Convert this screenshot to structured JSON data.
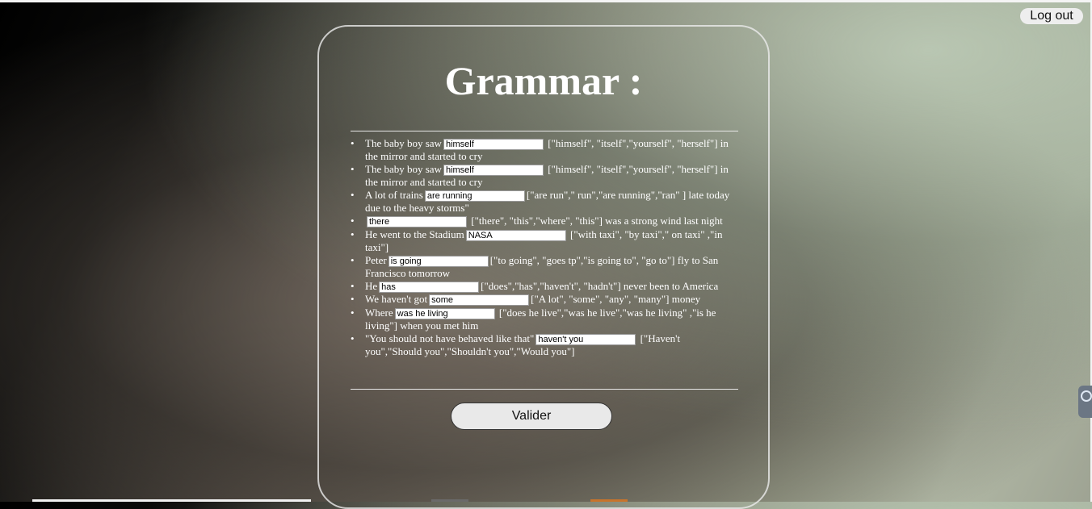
{
  "header": {
    "logout_label": "Log out"
  },
  "page": {
    "title": "Grammar :"
  },
  "questions": [
    {
      "before": "The baby boy saw",
      "answer": "himself",
      "after": "[\"himself\", \"itself\",\"yourself\", \"herself\"] in the mirror and started to cry"
    },
    {
      "before": "The baby boy saw",
      "answer": "himself",
      "after": "[\"himself\", \"itself\",\"yourself\", \"herself\"] in the mirror and started to cry"
    },
    {
      "before": "A lot of trains",
      "answer": "are running",
      "after": "[\"are run\",\" run\",\"are running\",\"ran\" ] late today due to the heavy storms\""
    },
    {
      "before": "",
      "answer": "there",
      "after": "[\"there\", \"this\",\"where\", \"this\"] was a strong wind last night"
    },
    {
      "before": "He went to the Stadium",
      "answer": "NASA",
      "after": "[\"with taxi\", \"by taxi\",\" on taxi\" ,\"in taxi\"]"
    },
    {
      "before": "Peter",
      "answer": "is going",
      "after": "[\"to going\", \"goes tp\",\"is going to\", \"go to\"] fly to San Francisco tomorrow"
    },
    {
      "before": "He",
      "answer": "has",
      "after": "[\"does\",\"has\",\"haven't\", \"hadn't\"] never been to America"
    },
    {
      "before": "We haven't got",
      "answer": "some",
      "after": "[\"A lot\", \"some\", \"any\", \"many\"] money"
    },
    {
      "before": "Where",
      "answer": "was he living",
      "after": "[\"does he live\",\"was he live\",\"was he living\" ,\"is he living\"] when you met him"
    },
    {
      "before": "\"You should not have behaved like that\"",
      "answer": "haven't you",
      "after": "[\"Haven't you\",\"Should you\",\"Shouldn't you\",\"Would you\"]"
    }
  ],
  "form": {
    "submit_label": "Valider"
  }
}
